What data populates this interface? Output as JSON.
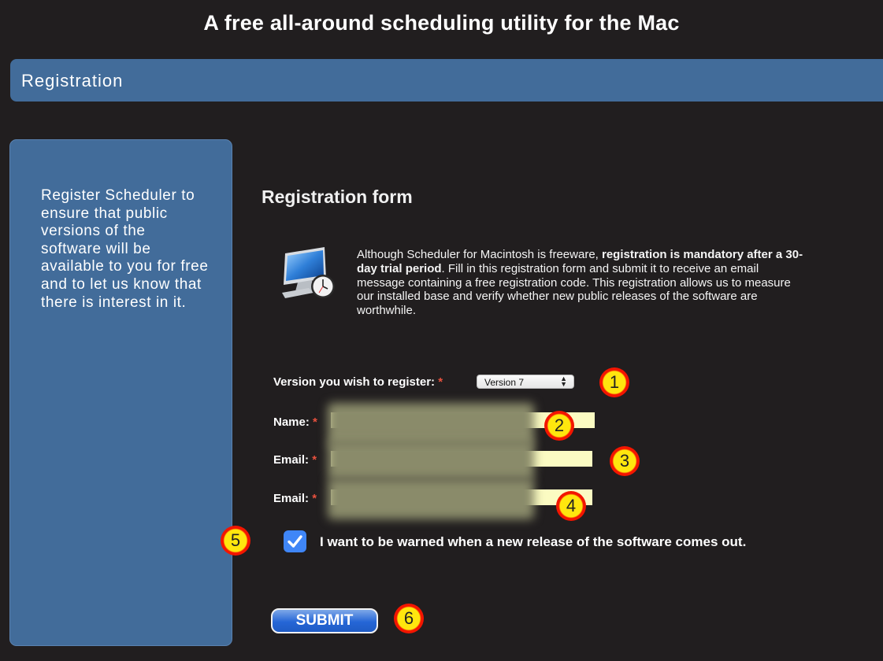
{
  "header": {
    "title": "A free all-around scheduling utility for the Mac"
  },
  "section": {
    "title": "Registration"
  },
  "sidebar": {
    "text": "Register Scheduler to ensure that public versions of the software will be available to you for free and to let us know that there is interest in it."
  },
  "form": {
    "heading": "Registration form",
    "intro_prefix": "Although Scheduler for Macintosh is freeware, ",
    "intro_bold": "registration is mandatory after a 30-day trial period",
    "intro_suffix": ". Fill in this registration form and submit it to receive an email message containing a free registration code. This registration allows us to measure our installed base and verify whether new public releases of the software are worthwhile.",
    "required_mark": "*",
    "version_label": "Version you wish to register:",
    "version_selected": "Version 7",
    "name_label": "Name:",
    "email_label": "Email:",
    "email_confirm_label": "Email:",
    "warn_checkbox_checked": true,
    "warn_label": "I want to be warned when a new release of the software comes out.",
    "submit_label": "SUBMIT"
  },
  "badges": [
    "1",
    "2",
    "3",
    "4",
    "5",
    "6"
  ],
  "colors": {
    "background": "#211e1f",
    "panel": "#426c9a",
    "field_fill": "#fbfbc2",
    "badge_fill": "#ffe60e",
    "badge_ring": "#f31500",
    "checkbox": "#3f86f7"
  },
  "icons": {
    "app_icon": "imac-clock-icon",
    "checkmark": "checkmark-icon",
    "select_arrows": "updown-arrows-icon"
  }
}
